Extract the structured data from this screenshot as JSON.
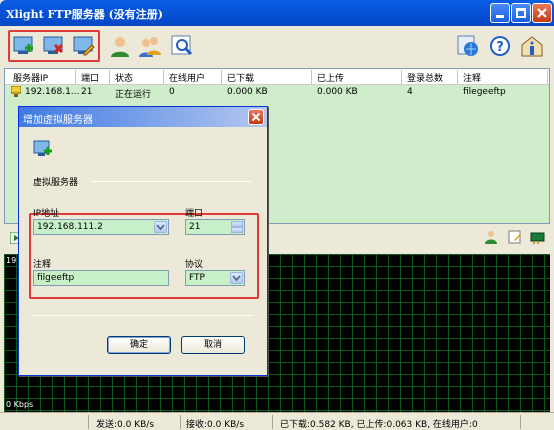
{
  "window": {
    "title": "Xlight FTP服务器 (没有注册)"
  },
  "table": {
    "headers": [
      "服务器IP",
      "端口",
      "状态",
      "在线用户",
      "已下载",
      "已上传",
      "登录总数",
      "注释"
    ],
    "rows": [
      {
        "ip": "192.168.1...",
        "port": "21",
        "status": "正在运行",
        "online": "0",
        "downloaded": "0.000 KB",
        "uploaded": "0.000 KB",
        "logins": "4",
        "note": "filegeeftp"
      }
    ]
  },
  "graph": {
    "top_label": "19",
    "bottom_label": "0 Kbps"
  },
  "status": {
    "send": "发送:0.0 KB/s",
    "recv": "接收:0.0 KB/s",
    "summary": "已下载:0.582 KB, 已上传:0.063 KB, 在线用户:0"
  },
  "dialog": {
    "title": "增加虚拟服务器",
    "section": "虚拟服务器",
    "ip_label": "IP地址",
    "ip_value": "192.168.111.2",
    "port_label": "端口",
    "port_value": "21",
    "note_label": "注释",
    "note_value": "filgeeftp",
    "protocol_label": "协议",
    "protocol_value": "FTP",
    "ok": "确定",
    "cancel": "取消"
  },
  "colors": {
    "accent": "#0553d8",
    "highlight": "#e03a3a",
    "list_bg": "#cfeccb",
    "graph_grid": "#0b5a18"
  }
}
